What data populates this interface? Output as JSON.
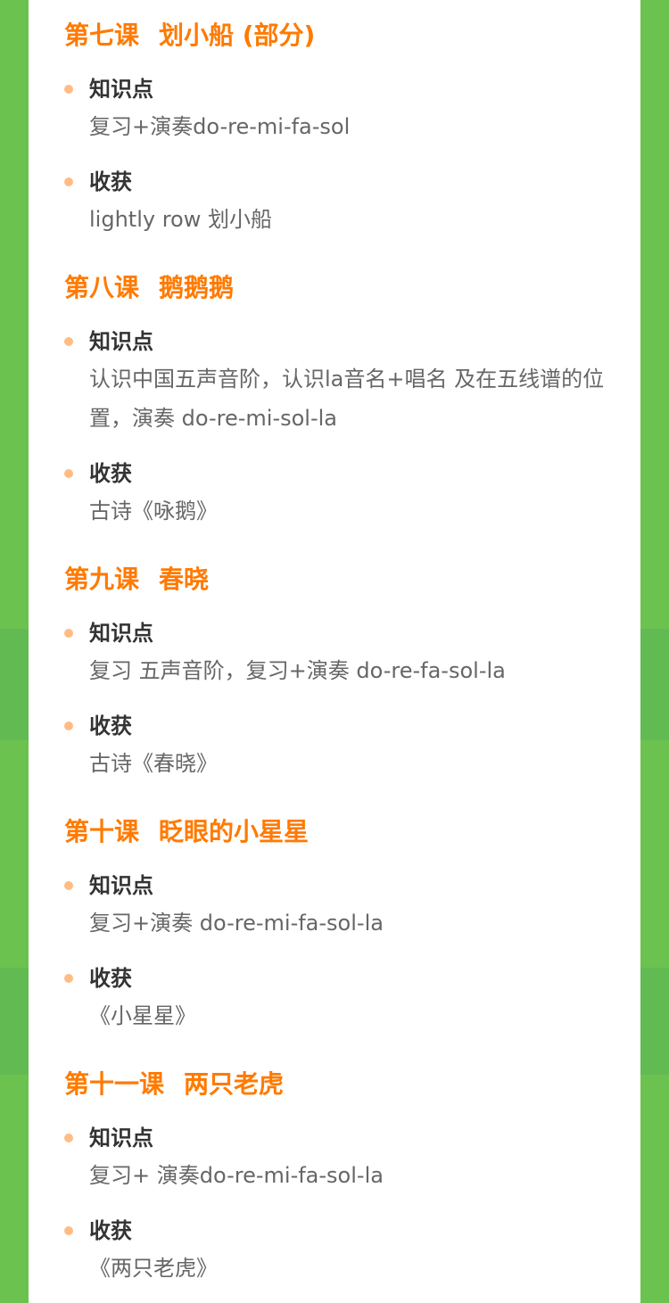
{
  "lessons": [
    {
      "number": "第七课",
      "name": "划小船 (部分)",
      "items": [
        {
          "label": "知识点",
          "text": "复习+演奏do-re-mi-fa-sol"
        },
        {
          "label": "收获",
          "text": "lightly row 划小船"
        }
      ]
    },
    {
      "number": "第八课",
      "name": "鹅鹅鹅",
      "items": [
        {
          "label": "知识点",
          "text": "认识中国五声音阶，认识la音名+唱名 及在五线谱的位置，演奏 do-re-mi-sol-la"
        },
        {
          "label": "收获",
          "text": "古诗《咏鹅》"
        }
      ]
    },
    {
      "number": "第九课",
      "name": "春晓",
      "items": [
        {
          "label": "知识点",
          "text": "复习 五声音阶，复习+演奏 do-re-fa-sol-la"
        },
        {
          "label": "收获",
          "text": "古诗《春晓》"
        }
      ]
    },
    {
      "number": "第十课",
      "name": "眨眼的小星星",
      "items": [
        {
          "label": "知识点",
          "text": "复习+演奏 do-re-mi-fa-sol-la"
        },
        {
          "label": "收获",
          "text": "《小星星》"
        }
      ]
    },
    {
      "number": "第十一课",
      "name": "两只老虎",
      "items": [
        {
          "label": "知识点",
          "text": "复习+ 演奏do-re-mi-fa-sol-la"
        },
        {
          "label": "收获",
          "text": "《两只老虎》"
        }
      ]
    }
  ]
}
